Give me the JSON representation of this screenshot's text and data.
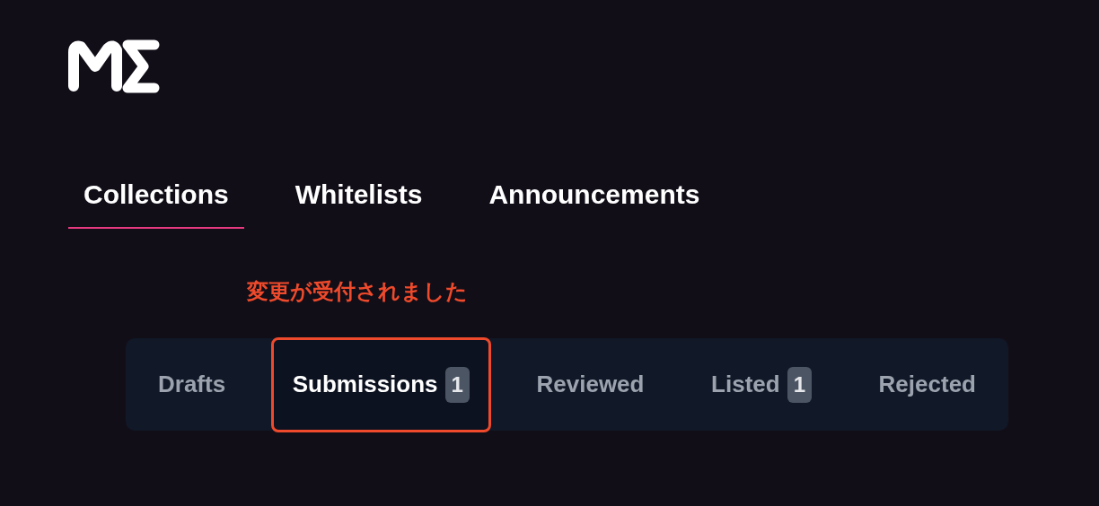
{
  "main_tabs": [
    {
      "label": "Collections",
      "selected": true
    },
    {
      "label": "Whitelists",
      "selected": false
    },
    {
      "label": "Announcements",
      "selected": false
    }
  ],
  "annotation": {
    "text": "変更が受付されました"
  },
  "sub_tabs": [
    {
      "label": "Drafts",
      "selected": false,
      "annotated": false
    },
    {
      "label": "Submissions",
      "count": "1",
      "selected": true,
      "annotated": true
    },
    {
      "label": "Reviewed",
      "selected": false,
      "annotated": false
    },
    {
      "label": "Listed",
      "count": "1",
      "selected": false,
      "annotated": false
    },
    {
      "label": "Rejected",
      "selected": false,
      "annotated": false
    }
  ]
}
